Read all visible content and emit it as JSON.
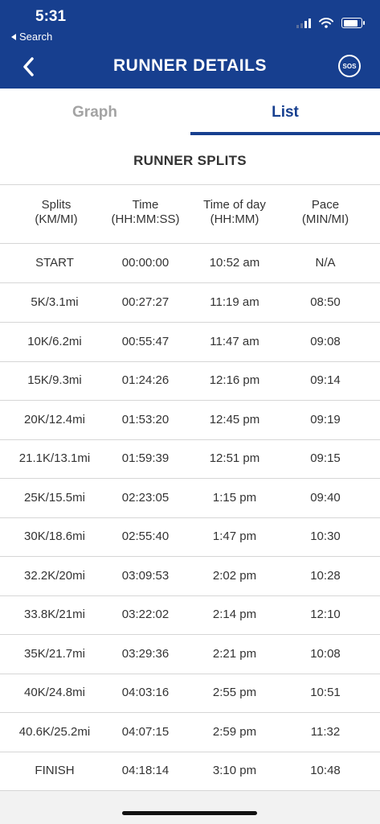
{
  "status_bar": {
    "time": "5:31",
    "back_label": "Search"
  },
  "header": {
    "title": "RUNNER DETAILS",
    "sos_label": "SOS"
  },
  "tabs": [
    {
      "label": "Graph",
      "selected": false
    },
    {
      "label": "List",
      "selected": true
    }
  ],
  "section_title": "RUNNER SPLITS",
  "columns": [
    {
      "line1": "Splits",
      "line2": "(KM/MI)"
    },
    {
      "line1": "Time",
      "line2": "(HH:MM:SS)"
    },
    {
      "line1": "Time of day",
      "line2": "(HH:MM)"
    },
    {
      "line1": "Pace",
      "line2": "(MIN/MI)"
    }
  ],
  "rows": [
    {
      "split": "START",
      "time": "00:00:00",
      "tod": "10:52 am",
      "pace": "N/A"
    },
    {
      "split": "5K/3.1mi",
      "time": "00:27:27",
      "tod": "11:19 am",
      "pace": "08:50"
    },
    {
      "split": "10K/6.2mi",
      "time": "00:55:47",
      "tod": "11:47 am",
      "pace": "09:08"
    },
    {
      "split": "15K/9.3mi",
      "time": "01:24:26",
      "tod": "12:16 pm",
      "pace": "09:14"
    },
    {
      "split": "20K/12.4mi",
      "time": "01:53:20",
      "tod": "12:45 pm",
      "pace": "09:19"
    },
    {
      "split": "21.1K/13.1mi",
      "time": "01:59:39",
      "tod": "12:51 pm",
      "pace": "09:15"
    },
    {
      "split": "25K/15.5mi",
      "time": "02:23:05",
      "tod": "1:15 pm",
      "pace": "09:40"
    },
    {
      "split": "30K/18.6mi",
      "time": "02:55:40",
      "tod": "1:47 pm",
      "pace": "10:30"
    },
    {
      "split": "32.2K/20mi",
      "time": "03:09:53",
      "tod": "2:02 pm",
      "pace": "10:28"
    },
    {
      "split": "33.8K/21mi",
      "time": "03:22:02",
      "tod": "2:14 pm",
      "pace": "12:10"
    },
    {
      "split": "35K/21.7mi",
      "time": "03:29:36",
      "tod": "2:21 pm",
      "pace": "10:08"
    },
    {
      "split": "40K/24.8mi",
      "time": "04:03:16",
      "tod": "2:55 pm",
      "pace": "10:51"
    },
    {
      "split": "40.6K/25.2mi",
      "time": "04:07:15",
      "tod": "2:59 pm",
      "pace": "11:32"
    },
    {
      "split": "FINISH",
      "time": "04:18:14",
      "tod": "3:10 pm",
      "pace": "10:48"
    }
  ],
  "colors": {
    "brand": "#173f8f",
    "inactive_tab": "#a3a3a3",
    "divider": "#d6d6d6"
  },
  "icons": [
    "back-chevron-icon",
    "signal-icon",
    "wifi-icon",
    "battery-icon",
    "sos-icon"
  ]
}
